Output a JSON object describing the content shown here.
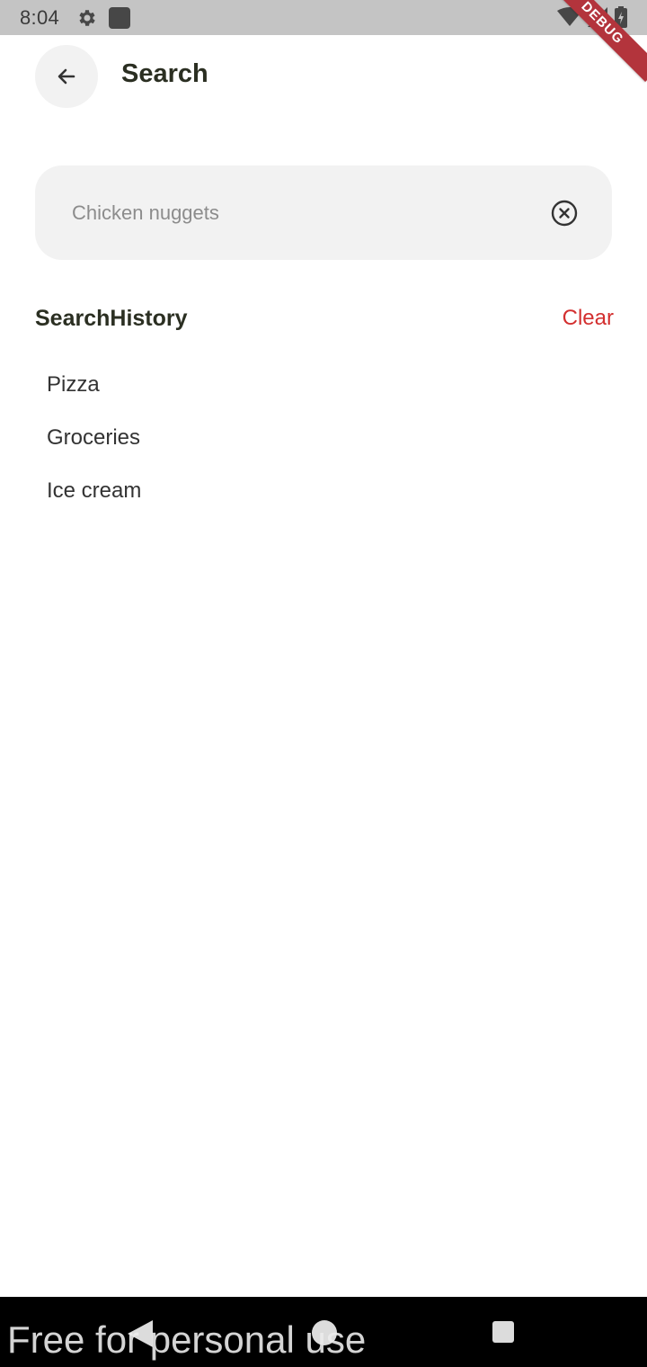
{
  "status_bar": {
    "time": "8:04",
    "icons": [
      "gear-icon",
      "app-square-icon",
      "wifi-icon",
      "signal-icon",
      "battery-charging-icon"
    ],
    "debug_label": "DEBUG"
  },
  "header": {
    "back_icon": "arrow-left-icon",
    "title": "Search"
  },
  "search": {
    "placeholder": "Chicken nuggets",
    "value": "",
    "clear_icon": "circle-x-icon"
  },
  "history": {
    "title": "SearchHistory",
    "clear_label": "Clear",
    "items": [
      "Pizza",
      "Groceries",
      "Ice cream"
    ]
  },
  "nav_bar": {
    "icons": [
      "nav-back-icon",
      "nav-home-icon",
      "nav-recents-icon"
    ]
  },
  "watermark": "Free for personal use",
  "colors": {
    "accent": "#d32f2f",
    "title_text": "#2b2f22",
    "surface": "#f2f2f2",
    "debug_ribbon": "#b3343c"
  }
}
